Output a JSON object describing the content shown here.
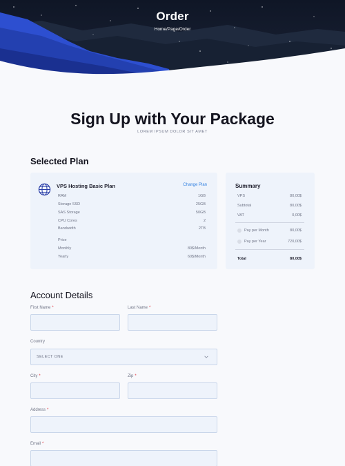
{
  "hero": {
    "title": "Order",
    "breadcrumb": "Home/Page/Order"
  },
  "heading": {
    "title": "Sign Up with Your Package",
    "subtitle": "LOREM IPSUM DOLOR SIT AMET"
  },
  "selected_plan": {
    "section_title": "Selected Plan",
    "plan_name": "VPS Hosting Basic Plan",
    "change_label": "Change Plan",
    "icon": "globe-icon",
    "specs": [
      {
        "label": "RAM",
        "value": "1GB"
      },
      {
        "label": "Storage SSD",
        "value": "25GB"
      },
      {
        "label": "SAS Storage",
        "value": "50GB"
      },
      {
        "label": "CPU Cores",
        "value": "2"
      },
      {
        "label": "Bandwidth",
        "value": "2TB"
      }
    ],
    "price_title": "Price",
    "prices": [
      {
        "label": "Monthly",
        "value": "80$/Month"
      },
      {
        "label": "Yearly",
        "value": "60$/Month"
      }
    ]
  },
  "summary": {
    "title": "Summary",
    "rows": [
      {
        "label": "VPS",
        "value": "80,00$"
      },
      {
        "label": "Subtotal",
        "value": "80,00$"
      },
      {
        "label": "VAT",
        "value": "0,00$"
      }
    ],
    "options": [
      {
        "label": "Pay per Month",
        "value": "80,00$"
      },
      {
        "label": "Pay per Year",
        "value": "720,00$"
      }
    ],
    "total_label": "Total",
    "total_value": "80,00$"
  },
  "account": {
    "section_title": "Account Details",
    "first_name_label": "First Name",
    "last_name_label": "Last Name",
    "country_label": "Country",
    "country_value": "SELECT ONE",
    "city_label": "City",
    "zip_label": "Zip",
    "address_label": "Address",
    "email_label": "Email",
    "required_mark": "*"
  },
  "colors": {
    "accent": "#2f7fe0",
    "required": "#e0303a",
    "hero_mountain": "#2d4fd0",
    "card_bg": "#eef3fb"
  }
}
